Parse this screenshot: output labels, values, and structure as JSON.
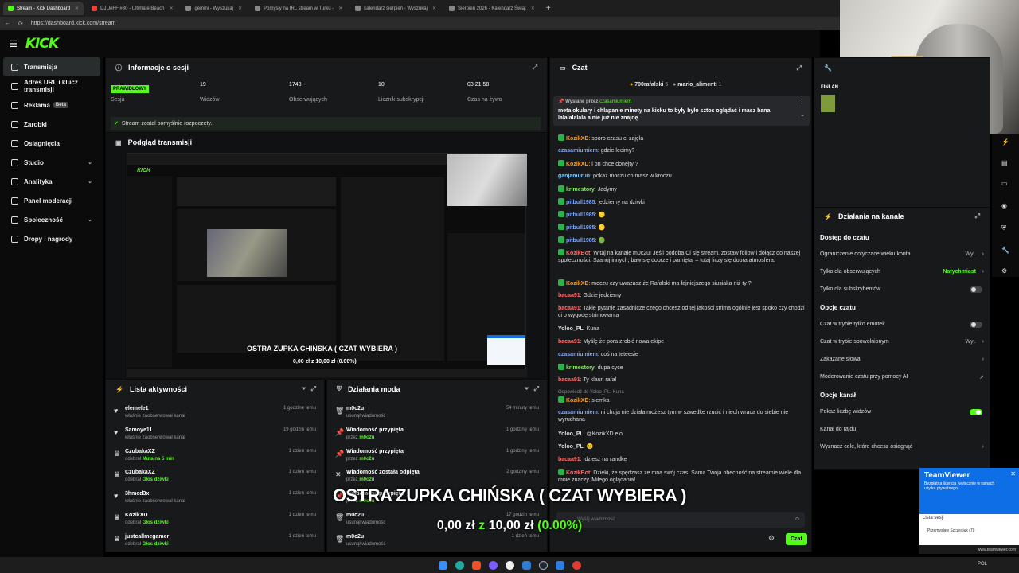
{
  "browser": {
    "tabs": [
      {
        "label": "Stream - Kick Dashboard",
        "active": true
      },
      {
        "label": "DJ JeFF #80 - Ultimate Beach",
        "active": false
      },
      {
        "label": "gemini - Wyszukaj",
        "active": false
      },
      {
        "label": "Pomysły na IRL stream w Turku -",
        "active": false
      },
      {
        "label": "kalendarz sierpień - Wyszukaj",
        "active": false
      },
      {
        "label": "Sierpień 2026 - Kalendarz Świąt",
        "active": false
      }
    ],
    "new_tab": "+",
    "url": "https://dashboard.kick.com/stream"
  },
  "brand": {
    "logo": "KICK",
    "accent": "#53fc18"
  },
  "sidebar": [
    {
      "label": "Transmisja",
      "active": true
    },
    {
      "label": "Adres URL i klucz transmisji"
    },
    {
      "label": "Reklama",
      "badge": "Beta"
    },
    {
      "label": "Zarobki"
    },
    {
      "label": "Osiągnięcia"
    },
    {
      "label": "Studio",
      "chev": "⌄"
    },
    {
      "label": "Analityka",
      "chev": "⌄"
    },
    {
      "label": "Panel moderacji"
    },
    {
      "label": "Społeczność",
      "chev": "⌄"
    },
    {
      "label": "Dropy i nagrody"
    }
  ],
  "session": {
    "title": "Informacje o sesji",
    "status_badge": "PRAWIDŁOWY",
    "stats": [
      {
        "value": "",
        "label": "Sesja"
      },
      {
        "value": "19",
        "label": "Widzów"
      },
      {
        "value": "1748",
        "label": "Obserwujących"
      },
      {
        "value": "10",
        "label": "Licznik subskrypcji"
      },
      {
        "value": "03:21:58",
        "label": "Czas na żywo"
      }
    ],
    "success": "Stream został pomyślnie rozpoczęty."
  },
  "preview": {
    "title": "Podgląd transmisji",
    "overlay_title": "OSTRA ZUPKA CHIŃSKA ( CZAT WYBIERA )",
    "overlay_amount": "0,00 zł z 10,00 zł (0.00%)"
  },
  "activity": {
    "title": "Lista aktywności",
    "items": [
      {
        "name": "elemele1",
        "desc": "właśnie zaobserwował kanał",
        "time": "1 godzinę temu",
        "icon": "♥"
      },
      {
        "name": "Samoye11",
        "desc": "właśnie zaobserwował kanał",
        "time": "19 godzin temu",
        "icon": "♥"
      },
      {
        "name": "CzubakaXZ",
        "desc": "odebrał ",
        "desc_hl": "Muta na 5 min",
        "time": "1 dzień temu",
        "icon": "♛"
      },
      {
        "name": "CzubakaXZ",
        "desc": "odebrał ",
        "desc_hl": "Głos dziwki",
        "time": "1 dzień temu",
        "icon": "♛"
      },
      {
        "name": "3hmed3x",
        "desc": "właśnie zaobserwował kanał",
        "time": "1 dzień temu",
        "icon": "♥"
      },
      {
        "name": "KozikXD",
        "desc": "odebrał ",
        "desc_hl": "Głos dziwki",
        "time": "1 dzień temu",
        "icon": "♛"
      },
      {
        "name": "justcallmegamer",
        "desc": "odebrał ",
        "desc_hl": "Głos dziwki",
        "time": "1 dzień temu",
        "icon": "♛"
      }
    ]
  },
  "modactions": {
    "title": "Działania moda",
    "items": [
      {
        "name": "m0c2u",
        "desc": "usunął wiadomość",
        "time": "54 minuty temu",
        "icon": "🗑"
      },
      {
        "name": "Wiadomość przypięta",
        "desc": "przez ",
        "desc_hl": "m0c2u",
        "time": "1 godzinę temu",
        "icon": "📌"
      },
      {
        "name": "Wiadomość przypięta",
        "desc": "przez ",
        "desc_hl": "m0c2u",
        "time": "1 godzinę temu",
        "icon": "📌"
      },
      {
        "name": "Wiadomość została odpięta",
        "desc": "przez ",
        "desc_hl": "m0c2u",
        "time": "2 godziny temu",
        "icon": "✕"
      },
      {
        "name": "Wiadomość przypięta",
        "desc": "przez ",
        "desc_hl": "m0c2u",
        "time": "",
        "icon": "📌"
      },
      {
        "name": "m0c2u",
        "desc": "usunął wiadomość",
        "time": "17 godzin temu",
        "icon": "🗑"
      },
      {
        "name": "m0c2u",
        "desc": "usunął wiadomość",
        "time": "1 dzień temu",
        "icon": "🗑"
      }
    ]
  },
  "chat": {
    "title": "Czat",
    "top_users": [
      {
        "name": "700rafalski",
        "count": "5"
      },
      {
        "name": "mario_alimenti",
        "count": "1"
      }
    ],
    "pinned_by_label": "Wysłane przez",
    "pinned_by": "czasamiumiem",
    "pinned_text": "meta okulary i chlapanie minety na kicku to były było sztos oglądać i masz bana lalalalalala a nie już nie znajdę",
    "messages": [
      {
        "user": "KozikXD",
        "color": "#ff9f1c",
        "badge": true,
        "text": "sporo czasu ci zajęła"
      },
      {
        "user": "czasamiumiem",
        "color": "#7ea7ff",
        "text": "gdzie lecimy?"
      },
      {
        "user": "KozikXD",
        "color": "#ff9f1c",
        "badge": true,
        "text": "i on chce donejty ?"
      },
      {
        "user": "ganjamurun",
        "color": "#7ec8ff",
        "text": "pokaż moczu co masz w kroczu"
      },
      {
        "user": "krimestory",
        "color": "#8ee66a",
        "badge": true,
        "text": "Jadymy"
      },
      {
        "user": "pitbull1985",
        "color": "#7ea7ff",
        "badge": true,
        "text": "jedziemy na dziwki"
      },
      {
        "user": "pitbull1985",
        "color": "#7ea7ff",
        "badge": true,
        "text": "🟡"
      },
      {
        "user": "pitbull1985",
        "color": "#7ea7ff",
        "badge": true,
        "text": "🟡"
      },
      {
        "user": "pitbull1985",
        "color": "#7ea7ff",
        "badge": true,
        "text": "🟢"
      },
      {
        "user": "KozikBot",
        "color": "#ff6b6b",
        "badge": true,
        "text": "Witaj na kanale m0c2u! Jeśli podoba Ci się stream, zostaw follow i dołącz do naszej społeczności. Szanuj innych, baw się dobrze i pamiętaj – tutaj liczy się dobra atmosfera."
      },
      {
        "user": "KozikXD",
        "color": "#ff9f1c",
        "badge": true,
        "text": "moczu czy uważasz że Rafalski ma fajniejszego siusiaka niż ty ?"
      },
      {
        "user": "bacaa91",
        "color": "#ff6b6b",
        "text": "Gdzie jedziemy"
      },
      {
        "user": "bacaa91",
        "color": "#ff6b6b",
        "text": "Takie pytanie zasadnicze czego chcesz od tej jakości strima ogólnie jest spoko czy chodzi ci o wygodę strimowania"
      },
      {
        "user": "Yoloo_PL",
        "color": "#dddddd",
        "text": "Kuna"
      },
      {
        "user": "bacaa91",
        "color": "#ff6b6b",
        "text": "Myślę że pora zrobić nowa ekipe"
      },
      {
        "user": "czasamiumiem",
        "color": "#7ea7ff",
        "text": "coś na teteesie"
      },
      {
        "user": "krimestory",
        "color": "#8ee66a",
        "badge": true,
        "text": "dupa cyce"
      },
      {
        "user": "bacaa91",
        "color": "#ff6b6b",
        "text": "Ty klaun rafal"
      },
      {
        "user": "KozikXD",
        "color": "#ff9f1c",
        "badge": true,
        "text": "siemka",
        "reply": "Odpowiedź do Yoloo_PL: Kuna"
      },
      {
        "user": "czasamiumiem",
        "color": "#7ea7ff",
        "text": "ni chuja nie działa możesz tym w szwedke rzucić i niech wraca do siebie nie wyruchana"
      },
      {
        "user": "Yoloo_PL",
        "color": "#dddddd",
        "text": "@KozikXD elo"
      },
      {
        "user": "Yoloo_PL",
        "color": "#dddddd",
        "text": "🙂"
      },
      {
        "user": "bacaa91",
        "color": "#ff6b6b",
        "text": "Idziesz na randke"
      },
      {
        "user": "KozikBot",
        "color": "#ff6b6b",
        "badge": true,
        "text": "Dzięki, że spędzasz ze mną swój czas. Sama Twoja obecność na streamie wiele dla mnie znaczy. Miłego oglądania!"
      }
    ],
    "input_placeholder": "Wyślij wiadomość",
    "send": "Czat"
  },
  "channel": {
    "title": "Działania na kanale",
    "sections": [
      {
        "heading": "Dostęp do czatu"
      },
      {
        "label": "Ograniczenie dotyczące wieku konta",
        "value": "Wył.",
        "ctl": "chev"
      },
      {
        "label": "Tylko dla obserwujących",
        "value": "Natychmiast",
        "ctl": "chev",
        "hl": true
      },
      {
        "label": "Tylko dla subskrybentów",
        "ctl": "toggle"
      },
      {
        "heading": "Opcje czatu"
      },
      {
        "label": "Czat w trybie tylko emotek",
        "ctl": "toggle"
      },
      {
        "label": "Czat w trybie spowolnionym",
        "value": "Wył.",
        "ctl": "chev"
      },
      {
        "label": "Zakazane słowa",
        "ctl": "chev"
      },
      {
        "label": "Moderowanie czatu przy pomocy AI",
        "ctl": "ext"
      },
      {
        "heading": "Opcje kanał"
      },
      {
        "label": "Pokaż liczbę widzów",
        "ctl": "toggle-on"
      },
      {
        "label": "Kanał do rajdu"
      },
      {
        "label": "Wyznacz cele, które chcesz osiągnąć",
        "ctl": "chev"
      }
    ],
    "top_label": "FINLAN"
  },
  "overlay": {
    "title": "OSTRA ZUPKA CHIŃSKA ( CZAT WYBIERA )",
    "amount_current": "0,00 zł",
    "amount_sep": "z",
    "amount_goal": "10,00 zł",
    "percent": "(0.00%)",
    "progress": 0.0
  },
  "teamviewer": {
    "brand": "TeamViewer",
    "notice": "Bezpłatna licencja (wyłącznie w ramach użytku prywatnego)",
    "session_list": "Lista sesji",
    "session_user": "Przemysław Szczesiuk (79",
    "url": "www.teamviewer.com"
  },
  "taskbar": {
    "lang": "POL"
  }
}
